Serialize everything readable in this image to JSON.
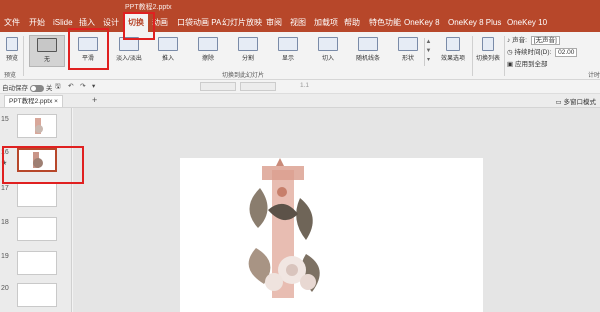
{
  "title": {
    "document": "PPT教程2.pptx"
  },
  "menu": {
    "tabs": [
      "文件",
      "开始",
      "iSlide",
      "插入",
      "设计",
      "切换",
      "动画",
      "口袋动画 PA",
      "幻灯片放映",
      "审阅",
      "视图",
      "加载项",
      "帮助",
      "特色功能",
      "OneKey 8",
      "OneKey 8 Plus",
      "OneKey 10"
    ],
    "active": "切换"
  },
  "ribbon": {
    "preview_label": "预览",
    "preview_group": "预览",
    "transitions": [
      "无",
      "平滑",
      "淡入/淡出",
      "推入",
      "擦除",
      "分割",
      "显示",
      "切入",
      "随机线条",
      "形状"
    ],
    "selected_transition": "平滑",
    "effect_options": "效果选项",
    "group_label": "切换到此幻灯片",
    "switch_list": "切换列表",
    "sound_label": "声音:",
    "sound_value": "[无声音]",
    "duration_label": "持续时间(D):",
    "duration_value": "02.00",
    "apply_all": "应用到全部",
    "timing_group": "计时"
  },
  "qat": {
    "autosave": "自动保存",
    "autosave_state": "关",
    "layout_dim": "1.1"
  },
  "docbar": {
    "tab_label": "PPT教程2.pptx",
    "multi_window": "多窗口模式"
  },
  "thumbnails": {
    "numbers": [
      "15",
      "16",
      "17",
      "18",
      "19",
      "20"
    ],
    "selected_number": "16",
    "star": "★"
  },
  "colors": {
    "brand": "#b7472a",
    "highlight": "#e02020"
  }
}
